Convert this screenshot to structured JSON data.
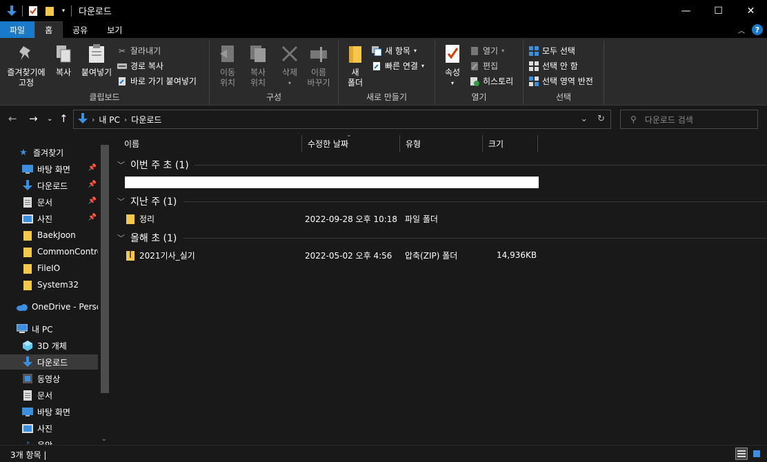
{
  "window": {
    "title": "다운로드",
    "controls": [
      "—",
      "☐",
      "✕"
    ]
  },
  "ribbon_tabs": [
    "파일",
    "홈",
    "공유",
    "보기"
  ],
  "ribbon": {
    "clipboard": {
      "pin": "즐겨찾기에\n고정",
      "copy": "복사",
      "paste": "붙여넣기",
      "cut": "잘라내기",
      "copy_path": "경로 복사",
      "paste_shortcut": "바로 가기 붙여넣기",
      "label": "클립보드"
    },
    "organize": {
      "move_to": "이동\n위치",
      "copy_to": "복사\n위치",
      "delete": "삭제",
      "rename": "이름\n바꾸기",
      "label": "구성"
    },
    "new": {
      "new_folder": "새\n폴더",
      "new_item": "새 항목",
      "easy_access": "빠른 연결",
      "label": "새로 만들기"
    },
    "open": {
      "properties": "속성",
      "open": "열기",
      "edit": "편집",
      "history": "히스토리",
      "label": "열기"
    },
    "select": {
      "select_all": "모두 선택",
      "select_none": "선택 안 함",
      "invert": "선택 영역 반전",
      "label": "선택"
    }
  },
  "address": {
    "path": [
      "내 PC",
      "다운로드"
    ],
    "search_placeholder": "다운로드 검색"
  },
  "nav_pane": {
    "quick_access": "즐겨찾기",
    "items": [
      {
        "label": "바탕 화면",
        "icon": "desktop-icon",
        "pinned": true
      },
      {
        "label": "다운로드",
        "icon": "download-icon",
        "pinned": true
      },
      {
        "label": "문서",
        "icon": "document-icon",
        "pinned": true
      },
      {
        "label": "사진",
        "icon": "pictures-icon",
        "pinned": true
      },
      {
        "label": "BaekJoon",
        "icon": "folder-icon",
        "pinned": false
      },
      {
        "label": "CommonContro",
        "icon": "folder-icon",
        "pinned": false
      },
      {
        "label": "FileIO",
        "icon": "folder-icon",
        "pinned": false
      },
      {
        "label": "System32",
        "icon": "folder-icon",
        "pinned": false
      }
    ],
    "onedrive": "OneDrive - Persor",
    "this_pc": "내 PC",
    "pc_items": [
      {
        "label": "3D 개체",
        "icon": "3d-objects-icon"
      },
      {
        "label": "다운로드",
        "icon": "download-icon"
      },
      {
        "label": "동영상",
        "icon": "video-icon"
      },
      {
        "label": "문서",
        "icon": "document-icon"
      },
      {
        "label": "바탕 화면",
        "icon": "desktop-icon"
      },
      {
        "label": "사진",
        "icon": "pictures-icon"
      },
      {
        "label": "음악",
        "icon": "music-icon"
      }
    ]
  },
  "columns": [
    "이름",
    "수정한 날짜",
    "유형",
    "크기"
  ],
  "groups": [
    {
      "header": "이번 주 초 (1)",
      "files": []
    },
    {
      "header": "지난 주 (1)",
      "files": [
        {
          "name": "정리",
          "date": "2022-09-28 오후 10:18",
          "type": "파일 폴더",
          "size": ""
        }
      ]
    },
    {
      "header": "올해 초 (1)",
      "files": [
        {
          "name": "2021기사_실기",
          "date": "2022-05-02 오후 4:56",
          "type": "압축(ZIP) 폴더",
          "size": "14,936KB"
        }
      ]
    }
  ],
  "status": {
    "count": "3개 항목"
  },
  "colors": {
    "accent": "#1979ca",
    "folder": "#f5c84c",
    "background": "#191919"
  }
}
